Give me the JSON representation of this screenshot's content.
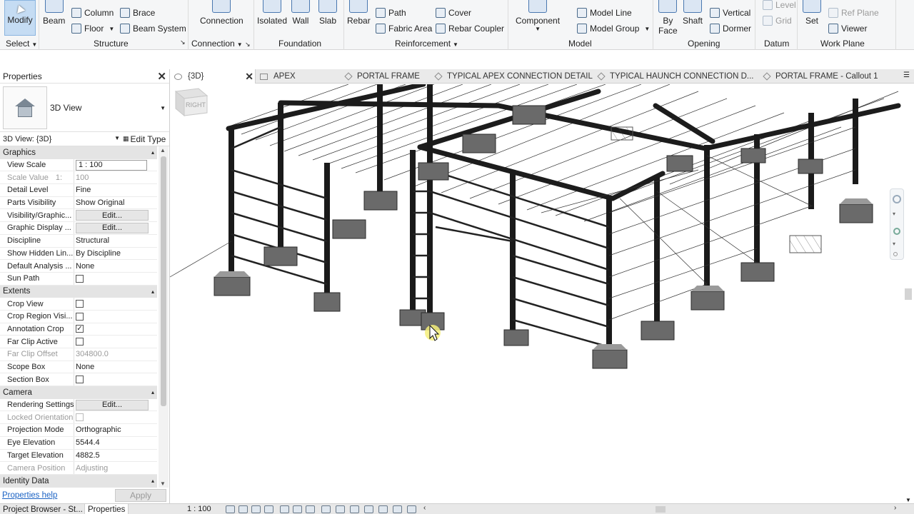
{
  "ribbon": {
    "modify": "Modify",
    "select": "Select",
    "structure": {
      "beam": "Beam",
      "column": "Column",
      "brace": "Brace",
      "floor": "Floor",
      "beam_system": "Beam  System",
      "panel": "Structure"
    },
    "connection": {
      "button": "Connection",
      "panel": "Connection"
    },
    "foundation": {
      "isolated": "Isolated",
      "wall": "Wall",
      "slab": "Slab",
      "panel": "Foundation"
    },
    "reinforcement": {
      "rebar": "Rebar",
      "path": "Path",
      "cover": "Cover",
      "fabric_area": "Fabric  Area",
      "rebar_coupler": "Rebar  Coupler",
      "panel": "Reinforcement"
    },
    "model": {
      "component": "Component",
      "model_line": "Model  Line",
      "model_group": "Model  Group",
      "panel": "Model"
    },
    "opening": {
      "by_face": "By",
      "by_face2": "Face",
      "shaft": "Shaft",
      "vertical": "Vertical",
      "dormer": "Dormer",
      "panel": "Opening"
    },
    "datum": {
      "level": "Level",
      "grid": "Grid",
      "panel": "Datum"
    },
    "work_plane": {
      "set": "Set",
      "ref_plane": "Ref  Plane",
      "viewer": "Viewer",
      "panel": "Work Plane"
    }
  },
  "properties": {
    "title": "Properties",
    "type_name": "3D View",
    "instance": "3D View: {3D}",
    "edit_type": "Edit Type",
    "sections": {
      "graphics": "Graphics",
      "extents": "Extents",
      "camera": "Camera",
      "identity": "Identity Data"
    },
    "rows": {
      "view_scale": {
        "name": "View Scale",
        "value": "1 : 100"
      },
      "scale_value": {
        "name": "Scale Value",
        "prefix": "1:",
        "value": "100"
      },
      "detail_level": {
        "name": "Detail Level",
        "value": "Fine"
      },
      "parts_visibility": {
        "name": "Parts Visibility",
        "value": "Show Original"
      },
      "visibility_graphics": {
        "name": "Visibility/Graphic...",
        "value": "Edit..."
      },
      "graphic_display": {
        "name": "Graphic Display ...",
        "value": "Edit..."
      },
      "discipline": {
        "name": "Discipline",
        "value": "Structural"
      },
      "show_hidden": {
        "name": "Show Hidden Lin...",
        "value": "By Discipline"
      },
      "default_analysis": {
        "name": "Default Analysis ...",
        "value": "None"
      },
      "sun_path": {
        "name": "Sun Path"
      },
      "crop_view": {
        "name": "Crop View"
      },
      "crop_region": {
        "name": "Crop Region Visi..."
      },
      "annotation_crop": {
        "name": "Annotation Crop",
        "check": "✓"
      },
      "far_clip_active": {
        "name": "Far Clip Active"
      },
      "far_clip_offset": {
        "name": "Far Clip Offset",
        "value": "304800.0"
      },
      "scope_box": {
        "name": "Scope Box",
        "value": "None"
      },
      "section_box": {
        "name": "Section Box"
      },
      "rendering_settings": {
        "name": "Rendering Settings",
        "value": "Edit..."
      },
      "locked_orientation": {
        "name": "Locked Orientation"
      },
      "projection_mode": {
        "name": "Projection Mode",
        "value": "Orthographic"
      },
      "eye_elevation": {
        "name": "Eye Elevation",
        "value": "5544.4"
      },
      "target_elevation": {
        "name": "Target Elevation",
        "value": "4882.5"
      },
      "camera_position": {
        "name": "Camera Position",
        "value": "Adjusting"
      }
    },
    "help": "Properties help",
    "apply": "Apply"
  },
  "tabs": [
    {
      "label": "{3D}"
    },
    {
      "label": "APEX"
    },
    {
      "label": "PORTAL FRAME"
    },
    {
      "label": "TYPICAL APEX CONNECTION DETAIL"
    },
    {
      "label": "TYPICAL HAUNCH CONNECTION D..."
    },
    {
      "label": "PORTAL FRAME - Callout 1"
    }
  ],
  "viewcube": {
    "face": "RIGHT"
  },
  "bottom": {
    "project_browser": "Project Browser - St...",
    "properties": "Properties",
    "scale": "1 : 100"
  }
}
